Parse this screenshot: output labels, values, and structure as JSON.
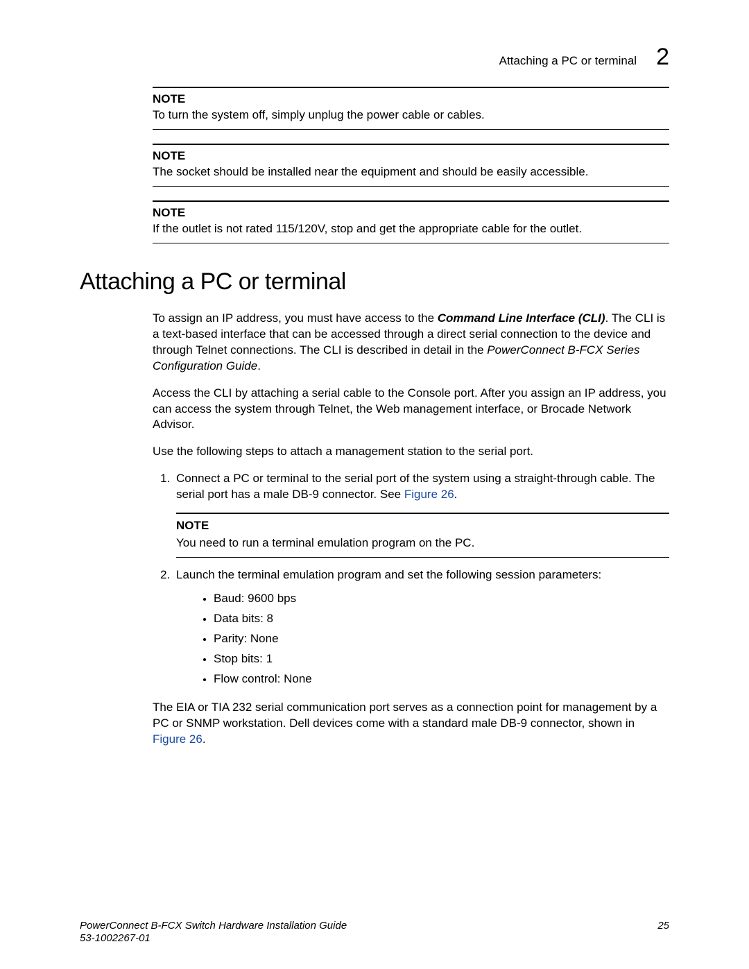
{
  "header": {
    "running_title": "Attaching a PC or terminal",
    "chapter_number": "2"
  },
  "notes_top": [
    {
      "label": "NOTE",
      "text": "To turn the system off, simply unplug the power cable or cables."
    },
    {
      "label": "NOTE",
      "text": "The socket should be installed near the equipment and should be easily accessible."
    },
    {
      "label": "NOTE",
      "text": "If the outlet is not rated 115/120V, stop and get the appropriate cable for the outlet."
    }
  ],
  "heading": "Attaching a PC or terminal",
  "para1": {
    "pre": "To assign an IP address, you must have access to the ",
    "cli": "Command Line Interface (CLI)",
    "mid": ". The CLI is a text-based interface that can be accessed through a direct serial connection to the device and through Telnet connections. The CLI is described in detail in the ",
    "guide": "PowerConnect B-FCX Series Configuration Guide",
    "post": "."
  },
  "para2": "Access the CLI by attaching a serial cable to the Console port. After you assign an IP address, you can access the system through Telnet, the Web management interface, or Brocade Network Advisor.",
  "para3": "Use the following steps to attach a management station to the serial port.",
  "step1": {
    "text_pre": "Connect a PC or terminal to the serial port of the system using a straight-through cable. The serial port has a male DB-9 connector. See ",
    "link": "Figure 26",
    "text_post": "."
  },
  "note_inline": {
    "label": "NOTE",
    "text": "You need to run a terminal emulation program on the PC."
  },
  "step2": {
    "text": "Launch the terminal emulation program and set the following session parameters:",
    "bullets": [
      "Baud:  9600 bps",
      "Data bits:  8",
      "Parity:  None",
      "Stop bits:  1",
      "Flow control:  None"
    ]
  },
  "para4": {
    "pre": "The EIA or TIA 232 serial communication port serves as a connection point for management by a PC or SNMP workstation. Dell devices come with a standard male DB-9 connector, shown in ",
    "link": "Figure 26",
    "post": "."
  },
  "footer": {
    "title": "PowerConnect B-FCX Switch Hardware Installation Guide",
    "docnum": "53-1002267-01",
    "page": "25"
  }
}
